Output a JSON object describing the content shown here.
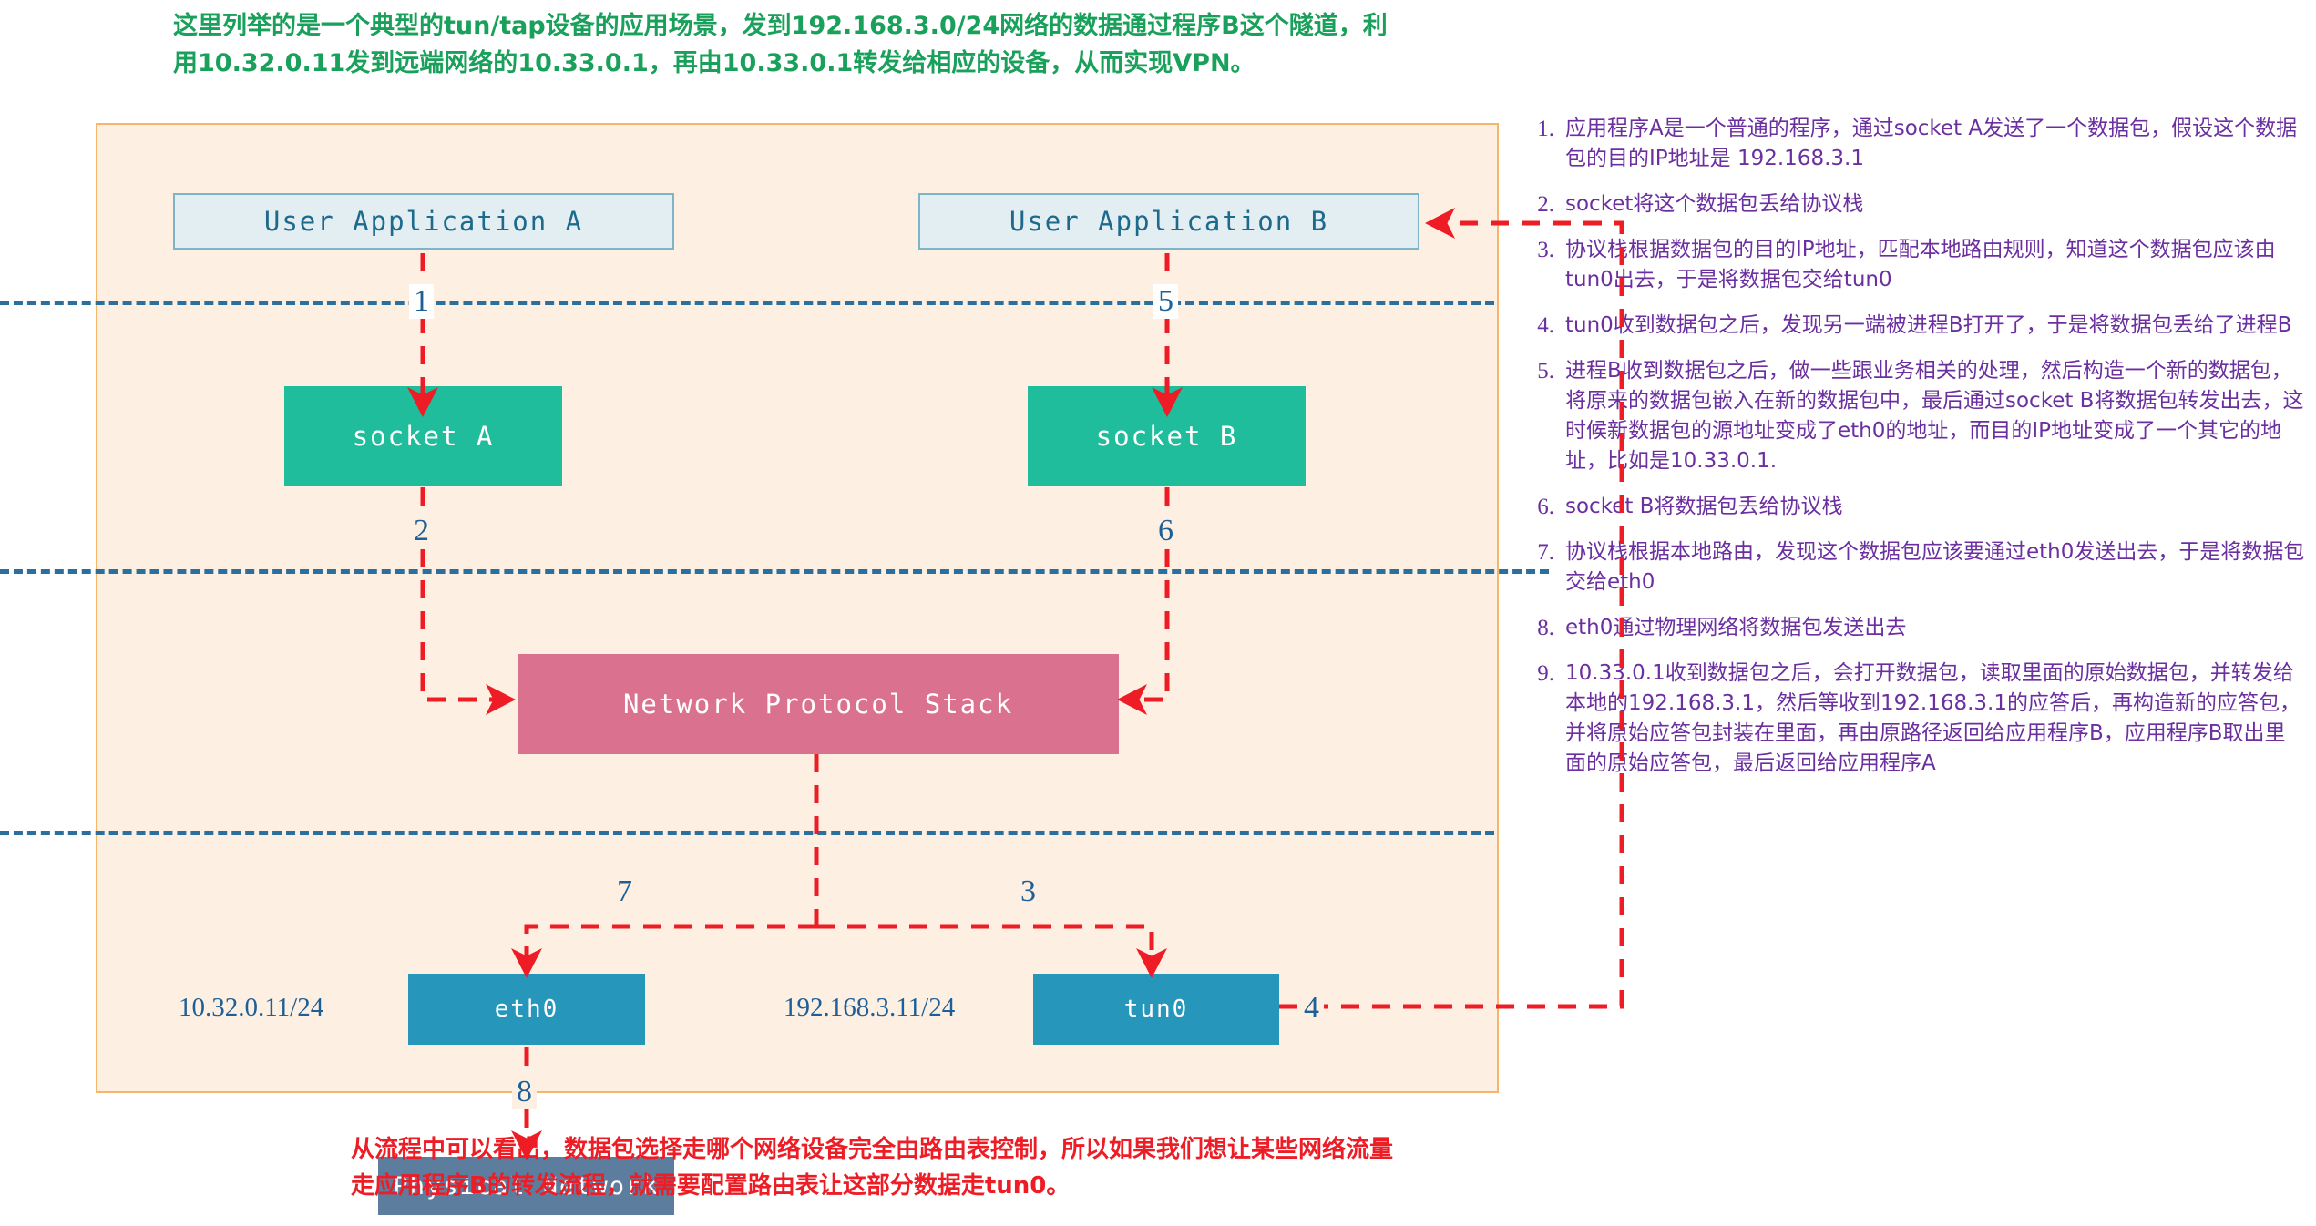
{
  "header_note": "这里列举的是一个典型的tun/tap设备的应用场景，发到192.168.3.0/24网络的数据通过程序B这个隧道，利用10.32.0.11发到远端网络的10.33.0.1，再由10.33.0.1转发给相应的设备，从而实现VPN。",
  "bottom_note": "从流程中可以看出，数据包选择走哪个网络设备完全由路由表控制，所以如果我们想让某些网络流量走应用程序B的转发流程，就需要配置路由表让这部分数据走tun0。",
  "colors": {
    "container_fill": "#fdf0e3",
    "container_border": "#f5b66b",
    "app_fill": "#e3eef3",
    "app_border": "#7fb3c8",
    "app_text": "#1d6a8c",
    "socket_fill": "#1fbd9c",
    "stack_fill": "#d9718f",
    "iface_fill": "#2697bb",
    "physical_fill": "#5d7d9e",
    "arrow_red": "#ee1c25",
    "separator_blue": "#2a6f9e",
    "label_blue": "#1d5f96",
    "header_green": "#19a05a",
    "list_purple": "#6b2fa0"
  },
  "diagram": {
    "nodes": {
      "app_a": "User Application A",
      "app_b": "User Application B",
      "socket_a": "socket A",
      "socket_b": "socket B",
      "stack": "Network Protocol Stack",
      "eth0": "eth0",
      "tun0": "tun0",
      "physical": "Physical Network"
    },
    "ip_labels": {
      "eth0_ip": "10.32.0.11/24",
      "tun0_ip": "192.168.3.11/24"
    },
    "step_numbers": {
      "s1": "1",
      "s2": "2",
      "s3": "3",
      "s4": "4",
      "s5": "5",
      "s6": "6",
      "s7": "7",
      "s8": "8"
    }
  },
  "steps": [
    {
      "marker": "1.",
      "text": "应用程序A是一个普通的程序，通过socket A发送了一个数据包，假设这个数据包的目的IP地址是 192.168.3.1"
    },
    {
      "marker": "2.",
      "text": "socket将这个数据包丢给协议栈"
    },
    {
      "marker": "3.",
      "text": "协议栈根据数据包的目的IP地址，匹配本地路由规则，知道这个数据包应该由tun0出去，于是将数据包交给tun0"
    },
    {
      "marker": "4.",
      "text": "tun0收到数据包之后，发现另一端被进程B打开了，于是将数据包丢给了进程B"
    },
    {
      "marker": "5.",
      "text": "进程B收到数据包之后，做一些跟业务相关的处理，然后构造一个新的数据包，将原来的数据包嵌入在新的数据包中，最后通过socket B将数据包转发出去，这时候新数据包的源地址变成了eth0的地址，而目的IP地址变成了一个其它的地址，比如是10.33.0.1."
    },
    {
      "marker": "6.",
      "text": "socket B将数据包丢给协议栈"
    },
    {
      "marker": "7.",
      "text": "协议栈根据本地路由，发现这个数据包应该要通过eth0发送出去，于是将数据包交给eth0"
    },
    {
      "marker": "8.",
      "text": "eth0通过物理网络将数据包发送出去"
    },
    {
      "marker": "9.",
      "text": "10.33.0.1收到数据包之后，会打开数据包，读取里面的原始数据包，并转发给本地的192.168.3.1，然后等收到192.168.3.1的应答后，再构造新的应答包，并将原始应答包封装在里面，再由原路径返回给应用程序B，应用程序B取出里面的原始应答包，最后返回给应用程序A"
    }
  ]
}
